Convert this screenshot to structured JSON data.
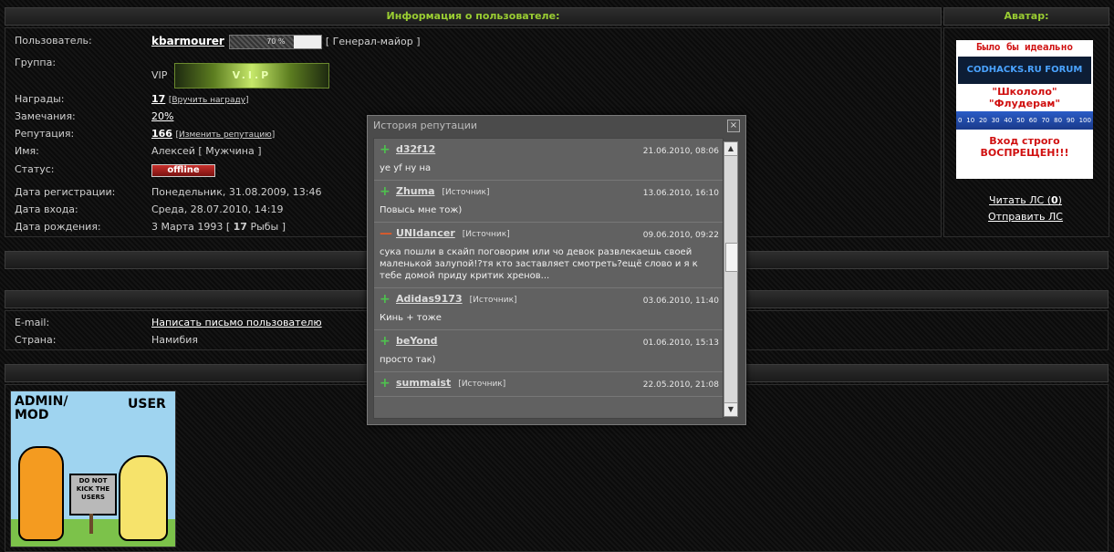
{
  "user_info": {
    "header": "Информация о пользователе:",
    "username_label": "Пользователь:",
    "username": "kbarmourer",
    "rank_percent_text": "70 %",
    "rank_progress": 0.7,
    "rank": "[ Генерал-майор ]",
    "group_label": "Группа:",
    "group_value": "VIP",
    "group_banner_text": "V.I.P",
    "awards_label": "Награды:",
    "awards_value": "17",
    "awards_action": "Вручить награду",
    "warnings_label": "Замечания:",
    "warnings_value": "20%",
    "rep_label": "Репутация:",
    "rep_value": "166",
    "rep_action": "Изменить репутацию",
    "name_label": "Имя:",
    "name_value": "Алексей [ Мужчина ]",
    "status_label": "Статус:",
    "status_value": "offline",
    "regdate_label": "Дата регистрации:",
    "regdate_value": "Понедельник, 31.08.2009, 13:46",
    "login_label": "Дата входа:",
    "login_value": "Среда, 28.07.2010, 14:19",
    "birth_label": "Дата рождения:",
    "birth_value_pre": "3 Марта 1993 [ ",
    "birth_age": "17",
    "birth_value_post": " Рыбы ]"
  },
  "avatar": {
    "header": "Аватар:",
    "line1": "Было бы идеально",
    "forum": "CODHACKS.RU FORUM",
    "line2": "\"Школоло\"",
    "line3": "\"Флудерам\"",
    "ruler_marks": [
      "0",
      "10",
      "20",
      "30",
      "40",
      "50",
      "60",
      "70",
      "80",
      "90",
      "100"
    ],
    "line4": "Вход строго",
    "line5": "ВОСПРЕЩЕН!!!",
    "read_pm_pre": "Читать ЛС (",
    "read_pm_count": "0",
    "read_pm_post": ")",
    "send_pm": "Отправить ЛС"
  },
  "contact": {
    "email_label": "E-mail:",
    "email_value": "Написать письмо пользователю",
    "country_label": "Страна:",
    "country_value": "Намибия"
  },
  "signature": {
    "admin_label": "ADMIN/ MOD",
    "user_label": "USER",
    "sign_text": "DO NOT KICK THE USERS"
  },
  "modal": {
    "title": "История репутации",
    "close": "×",
    "entries": [
      {
        "sign": "plus",
        "name": "d32f12",
        "source": "",
        "date": "21.06.2010, 08:06",
        "text": "ye yf ну на"
      },
      {
        "sign": "plus",
        "name": "Zhuma",
        "source": "[Источник]",
        "date": "13.06.2010, 16:10",
        "text": "Повысь мне тож)"
      },
      {
        "sign": "minus",
        "name": "UNIdancer",
        "source": "[Источник]",
        "date": "09.06.2010, 09:22",
        "text": "сука пошли в скайп поговорим или чо девок развлекаешь своей маленькой залупой!?тя кто заставляет смотреть?ещё слово и я к тебе домой приду критик хренов..."
      },
      {
        "sign": "plus",
        "name": "Adidas9173",
        "source": "[Источник]",
        "date": "03.06.2010, 11:40",
        "text": "Кинь + тоже"
      },
      {
        "sign": "plus",
        "name": "beYond",
        "source": "",
        "date": "01.06.2010, 15:13",
        "text": "просто так)"
      },
      {
        "sign": "plus",
        "name": "summaist",
        "source": "[Источник]",
        "date": "22.05.2010, 21:08",
        "text": ""
      }
    ]
  }
}
